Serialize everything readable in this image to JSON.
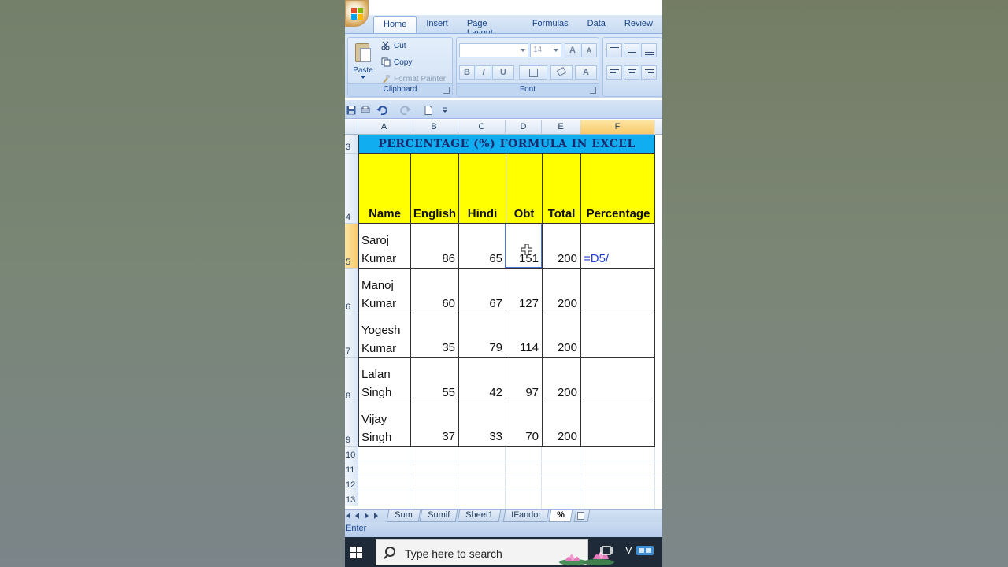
{
  "ribbon": {
    "tabs": [
      "Home",
      "Insert",
      "Page Layout",
      "Formulas",
      "Data",
      "Review"
    ],
    "active_tab": "Home",
    "clipboard": {
      "paste_label": "Paste",
      "cut_label": "Cut",
      "copy_label": "Copy",
      "format_painter_label": "Format Painter",
      "group_label": "Clipboard"
    },
    "font": {
      "font_name": "",
      "font_size": "14",
      "grow_label": "A",
      "shrink_label": "A",
      "bold_label": "B",
      "italic_label": "I",
      "underline_label": "U",
      "fill_label": "",
      "color_label": "A",
      "group_label": "Font"
    }
  },
  "sheet": {
    "columns": [
      "A",
      "B",
      "C",
      "D",
      "E",
      "F"
    ],
    "rows": [
      "3",
      "4",
      "5",
      "6",
      "7",
      "8",
      "9",
      "10",
      "11",
      "12",
      "13"
    ],
    "title": "PERCENTAGE (%) FORMULA IN EXCEL",
    "headers": [
      "Name",
      "English",
      "Hindi",
      "Obt",
      "Total",
      "Percentage"
    ],
    "data": [
      {
        "name1": "Saroj",
        "name2": "Kumar",
        "english": "86",
        "hindi": "65",
        "obt": "151",
        "total": "200",
        "percentage": "=D5/"
      },
      {
        "name1": "Manoj",
        "name2": "Kumar",
        "english": "60",
        "hindi": "67",
        "obt": "127",
        "total": "200",
        "percentage": ""
      },
      {
        "name1": "Yogesh",
        "name2": "Kumar",
        "english": "35",
        "hindi": "79",
        "obt": "114",
        "total": "200",
        "percentage": ""
      },
      {
        "name1": "Lalan",
        "name2": "Singh",
        "english": "55",
        "hindi": "42",
        "obt": "97",
        "total": "200",
        "percentage": ""
      },
      {
        "name1": "Vijay",
        "name2": "Singh",
        "english": "37",
        "hindi": "33",
        "obt": "70",
        "total": "200",
        "percentage": ""
      }
    ]
  },
  "sheet_tabs": [
    "Sum",
    "Sumif",
    "Sheet1",
    "IFandor",
    "%"
  ],
  "active_sheet": "%",
  "status": "Enter",
  "taskbar": {
    "search_placeholder": "Type here to search",
    "tray_text": "V"
  },
  "colors": {
    "title_band": "#10aef0",
    "header_band": "#ffff00",
    "formula_text": "#1f3fd6"
  }
}
